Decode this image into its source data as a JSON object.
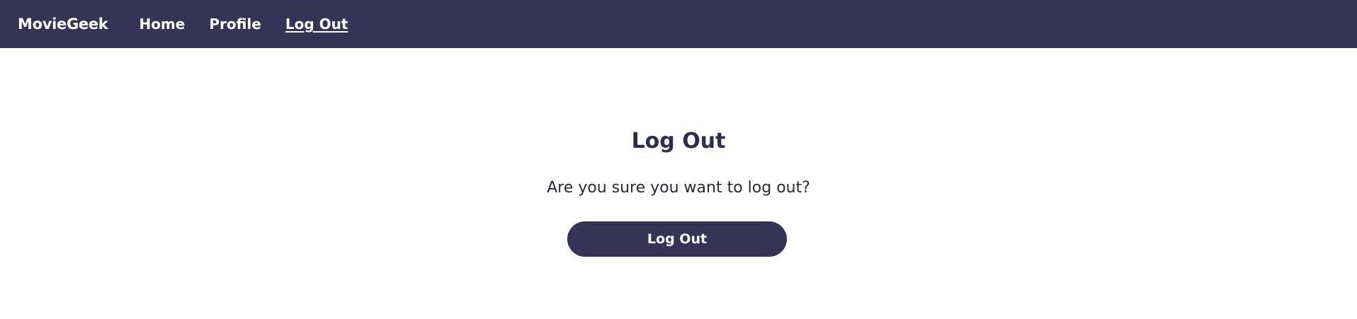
{
  "navbar": {
    "brand": "MovieGeek",
    "links": [
      {
        "label": "Home"
      },
      {
        "label": "Profile"
      },
      {
        "label": "Log Out"
      }
    ],
    "background": "#363357"
  },
  "main": {
    "title": "Log Out",
    "message": "Are you sure you want to log out?",
    "button_label": "Log Out"
  }
}
